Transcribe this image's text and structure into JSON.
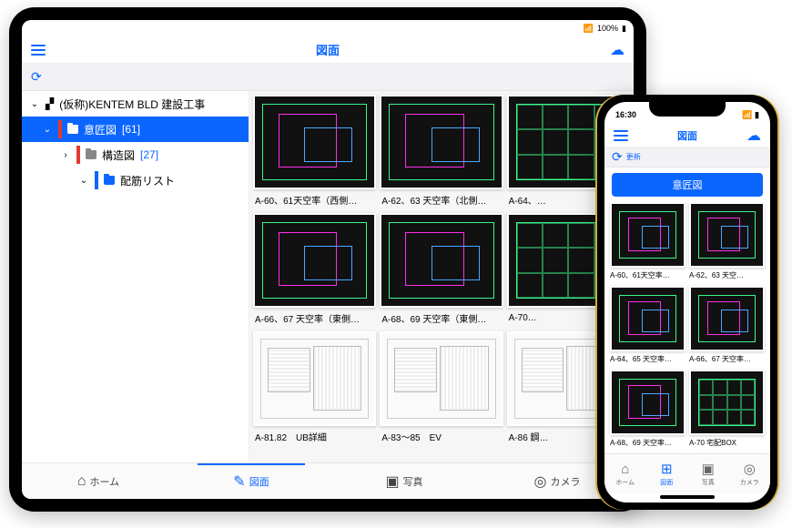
{
  "status": {
    "wifi": "100%"
  },
  "nav_title": "図面",
  "tree": {
    "root": "(仮称)KENTEM BLD 建設工事",
    "items": [
      {
        "label": "意匠図",
        "count": "[61]"
      },
      {
        "label": "構造図",
        "count": "[27]"
      },
      {
        "label": "配筋リスト"
      }
    ]
  },
  "grid": [
    "A-60、61天空率（西側…",
    "A-62、63 天空率（北側…",
    "A-64、…",
    "A-66、67 天空率（東側…",
    "A-68、69 天空率（東側…",
    "A-70…",
    "A-81.82　UB詳細",
    "A-83～85　EV",
    "A-86 鋼…"
  ],
  "tabs": [
    {
      "label": "ホーム"
    },
    {
      "label": "図面"
    },
    {
      "label": "写真"
    },
    {
      "label": "カメラ"
    }
  ],
  "phone": {
    "time": "16:30",
    "nav_title": "図面",
    "tool_label": "更新",
    "banner": "意匠図",
    "grid": [
      "A-60、61天空率…",
      "A-62、63 天空…",
      "A-64、65 天空率…",
      "A-66、67 天空率…",
      "A-68、69 天空率…",
      "A-70 宅配BOX"
    ],
    "tabs": [
      {
        "label": "ホーム"
      },
      {
        "label": "図面"
      },
      {
        "label": "写真"
      },
      {
        "label": "カメラ"
      }
    ]
  }
}
